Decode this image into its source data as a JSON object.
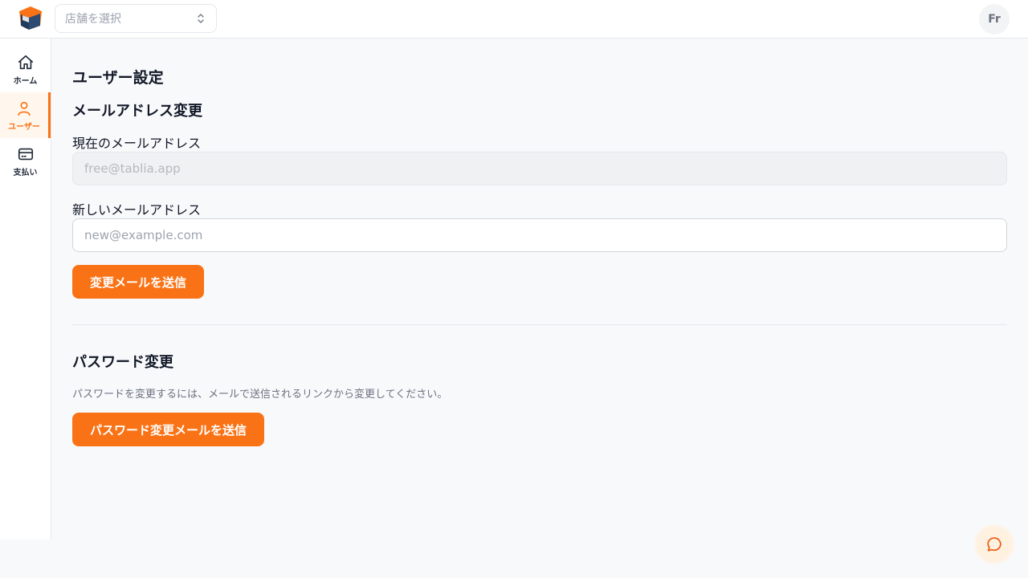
{
  "header": {
    "store_select": {
      "placeholder": "店舗を選択"
    },
    "avatar_initials": "Fr"
  },
  "sidebar": {
    "items": [
      {
        "label": "ホーム",
        "icon": "home-icon",
        "active": false
      },
      {
        "label": "ユーザー",
        "icon": "user-icon",
        "active": true
      },
      {
        "label": "支払い",
        "icon": "credit-card-icon",
        "active": false
      }
    ]
  },
  "main": {
    "page_title": "ユーザー設定",
    "email_section": {
      "title": "メールアドレス変更",
      "current_label": "現在のメールアドレス",
      "current_value": "free@tablia.app",
      "new_label": "新しいメールアドレス",
      "new_placeholder": "new@example.com",
      "submit_label": "変更メールを送信"
    },
    "password_section": {
      "title": "パスワード変更",
      "hint": "パスワードを変更するには、メールで送信されるリンクから変更してください。",
      "submit_label": "パスワード変更メールを送信"
    }
  },
  "colors": {
    "accent": "#f97316",
    "accent_bg": "#fff7ed",
    "page_bg": "#f8f9fb",
    "border": "#e5e7eb"
  }
}
